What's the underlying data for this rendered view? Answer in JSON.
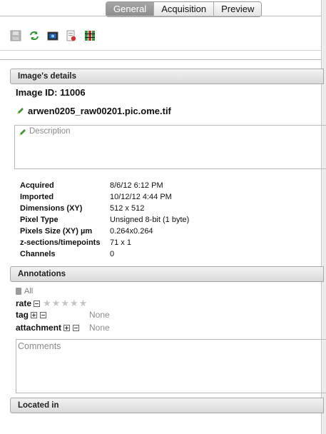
{
  "tabs": [
    {
      "label": "General",
      "active": true
    },
    {
      "label": "Acquisition",
      "active": false
    },
    {
      "label": "Preview",
      "active": false
    }
  ],
  "toolbar": {
    "icons": [
      "save-icon",
      "refresh-icon",
      "image-viewer-icon",
      "export-icon",
      "color-grid-icon"
    ]
  },
  "details": {
    "header": "Image's details",
    "image_id": "Image ID: 11006",
    "filename": "arwen0205_raw00201.pic.ome.tif",
    "description_placeholder": "Description",
    "meta": [
      {
        "key": "Acquired",
        "value": "8/6/12 6:12 PM"
      },
      {
        "key": "Imported",
        "value": "10/12/12 4:44 PM"
      },
      {
        "key": "Dimensions (XY)",
        "value": "512 x 512"
      },
      {
        "key": "Pixel Type",
        "value": "Unsigned 8-bit (1 byte)"
      },
      {
        "key": "Pixels Size (XY) µm",
        "value": "0.264x0.264"
      },
      {
        "key": "z-sections/timepoints",
        "value": "71 x 1"
      },
      {
        "key": "Channels",
        "value": "0"
      }
    ]
  },
  "annotations": {
    "header": "Annotations",
    "filter": "All",
    "rate_label": "rate",
    "rating": 0,
    "rating_max": 5,
    "tag_label": "tag",
    "tag_value": "None",
    "attachment_label": "attachment",
    "attachment_value": "None",
    "comments_placeholder": "Comments"
  },
  "located_in": {
    "header": "Located in"
  }
}
